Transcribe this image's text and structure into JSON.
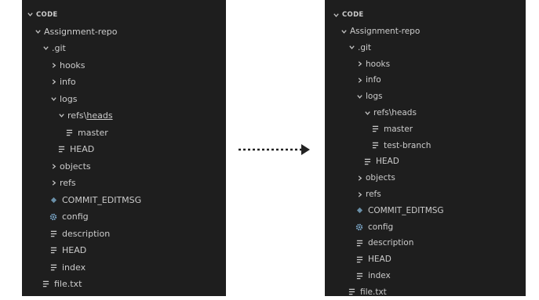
{
  "left": {
    "header": "CODE",
    "items": [
      {
        "label": "Assignment-repo",
        "depth": 1,
        "kind": "folder-open"
      },
      {
        "label": ".git",
        "depth": 2,
        "kind": "folder-open"
      },
      {
        "label": "hooks",
        "depth": 3,
        "kind": "folder-closed"
      },
      {
        "label": "info",
        "depth": 3,
        "kind": "folder-closed"
      },
      {
        "label": "logs",
        "depth": 3,
        "kind": "folder-open"
      },
      {
        "label": "refs\\",
        "label2": "heads",
        "depth": 4,
        "kind": "folder-open"
      },
      {
        "label": "master",
        "depth": 5,
        "kind": "file-lines"
      },
      {
        "label": "HEAD",
        "depth": 4,
        "kind": "file-lines"
      },
      {
        "label": "objects",
        "depth": 3,
        "kind": "folder-closed"
      },
      {
        "label": "refs",
        "depth": 3,
        "kind": "folder-closed"
      },
      {
        "label": "COMMIT_EDITMSG",
        "depth": 3,
        "kind": "file-diamond"
      },
      {
        "label": "config",
        "depth": 3,
        "kind": "file-gear"
      },
      {
        "label": "description",
        "depth": 3,
        "kind": "file-lines"
      },
      {
        "label": "HEAD",
        "depth": 3,
        "kind": "file-lines"
      },
      {
        "label": "index",
        "depth": 3,
        "kind": "file-lines"
      },
      {
        "label": "file.txt",
        "depth": 2,
        "kind": "file-lines"
      }
    ]
  },
  "right": {
    "header": "CODE",
    "items": [
      {
        "label": "Assignment-repo",
        "depth": 1,
        "kind": "folder-open"
      },
      {
        "label": ".git",
        "depth": 2,
        "kind": "folder-open"
      },
      {
        "label": "hooks",
        "depth": 3,
        "kind": "folder-closed"
      },
      {
        "label": "info",
        "depth": 3,
        "kind": "folder-closed"
      },
      {
        "label": "logs",
        "depth": 3,
        "kind": "folder-open"
      },
      {
        "label": "refs\\heads",
        "depth": 4,
        "kind": "folder-open"
      },
      {
        "label": "master",
        "depth": 5,
        "kind": "file-lines"
      },
      {
        "label": "test-branch",
        "depth": 5,
        "kind": "file-lines"
      },
      {
        "label": "HEAD",
        "depth": 4,
        "kind": "file-lines"
      },
      {
        "label": "objects",
        "depth": 3,
        "kind": "folder-closed"
      },
      {
        "label": "refs",
        "depth": 3,
        "kind": "folder-closed"
      },
      {
        "label": "COMMIT_EDITMSG",
        "depth": 3,
        "kind": "file-diamond"
      },
      {
        "label": "config",
        "depth": 3,
        "kind": "file-gear"
      },
      {
        "label": "description",
        "depth": 3,
        "kind": "file-lines"
      },
      {
        "label": "HEAD",
        "depth": 3,
        "kind": "file-lines"
      },
      {
        "label": "index",
        "depth": 3,
        "kind": "file-lines"
      },
      {
        "label": "file.txt",
        "depth": 2,
        "kind": "file-lines"
      }
    ]
  },
  "icons": {
    "folder-open": "chevron-down-icon",
    "folder-closed": "chevron-right-icon",
    "file-lines": "text-file-icon",
    "file-diamond": "commit-message-file-icon",
    "file-gear": "config-gear-icon"
  },
  "colors": {
    "panel_bg": "#1e1e1e",
    "text": "#cccccc",
    "diamond": "#6a8fa8",
    "gear": "#7aa6c8",
    "arrow": "#222222"
  }
}
